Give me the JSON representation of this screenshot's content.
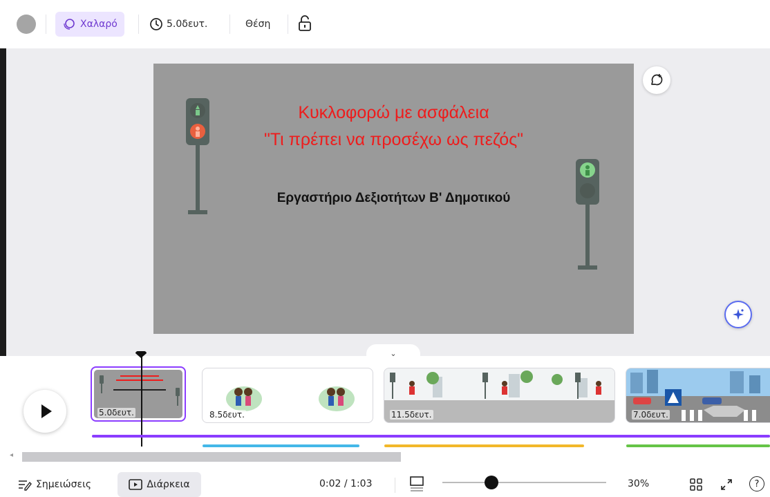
{
  "toolbar": {
    "animation_label": "Χαλαρό",
    "duration_label": "5.0δευτ.",
    "position_label": "Θέση"
  },
  "slide": {
    "title_lines": "Κυκλοφορώ με ασφάλεια\n\"Τι πρέπει να προσέχω ως πεζός\"",
    "subtitle": "Εργαστήριο Δεξιοτήτων Β' Δημοτικού"
  },
  "timeline": {
    "clips": [
      {
        "duration": "5.0δευτ."
      },
      {
        "duration": "8.5δευτ."
      },
      {
        "duration": "11.5δευτ."
      },
      {
        "duration": "7.0δευτ."
      }
    ]
  },
  "bottom_bar": {
    "notes_label": "Σημειώσεις",
    "duration_label": "Διάρκεια",
    "time_readout": "0:02 / 1:03",
    "zoom_level": "30%",
    "help_label": "?"
  },
  "colors": {
    "accent_purple": "#8b3dff",
    "track_blue": "#44b8e8",
    "track_yellow": "#f2b82a",
    "track_green": "#66c447",
    "title_red": "#ee1c1c"
  },
  "icons": [
    "color-swatch",
    "animation-icon",
    "clock-icon",
    "lock-icon",
    "comment-add-icon",
    "magic-sparkle-icon",
    "play-icon",
    "notes-icon",
    "duration-icon",
    "layout-icon",
    "grid-view-icon",
    "fullscreen-icon",
    "help-icon",
    "chevron-down-icon",
    "chevron-left-icon"
  ]
}
